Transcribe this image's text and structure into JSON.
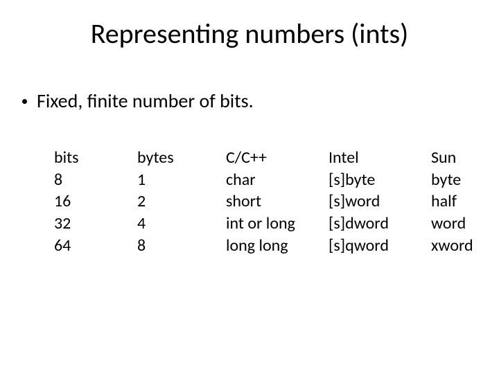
{
  "title": "Representing numbers (ints)",
  "bullet": "Fixed, finite number of bits.",
  "table": {
    "columns": [
      {
        "header": "bits",
        "rows": [
          "8",
          "16",
          "32",
          "64"
        ]
      },
      {
        "header": "bytes",
        "rows": [
          "1",
          "2",
          "4",
          "8"
        ]
      },
      {
        "header": "C/C++",
        "rows": [
          "char",
          "short",
          "int or long",
          "long long"
        ]
      },
      {
        "header": "Intel",
        "rows": [
          "[s]byte",
          "[s]word",
          "[s]dword",
          "[s]qword"
        ]
      },
      {
        "header": "Sun",
        "rows": [
          "byte",
          "half",
          "word",
          "xword"
        ]
      }
    ]
  }
}
